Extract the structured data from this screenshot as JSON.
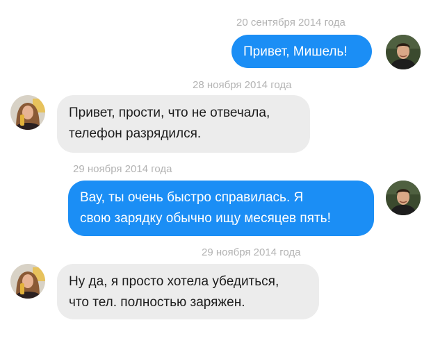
{
  "messages": [
    {
      "timestamp": "20 сентября 2014 года",
      "lines": [
        "Привет, Мишель!"
      ],
      "sender": "him"
    },
    {
      "timestamp": "28 ноября 2014 года",
      "lines": [
        "Привет, прости, что не отвечала,",
        "телефон разрядился."
      ],
      "sender": "her"
    },
    {
      "timestamp": "29 ноября 2014 года",
      "lines": [
        "Вау, ты очень быстро справилась. Я",
        "свою зарядку обычно ищу месяцев пять!"
      ],
      "sender": "him"
    },
    {
      "timestamp": "29 ноября 2014 года",
      "lines": [
        "Ну да, я просто хотела убедиться,",
        "что тел. полностью заряжен."
      ],
      "sender": "her"
    }
  ],
  "colors": {
    "outgoing_bubble": "#1b8ef5",
    "incoming_bubble": "#ececec",
    "timestamp_text": "#b3b3b3"
  },
  "icons": {
    "him_avatar": "man-avatar-icon",
    "her_avatar": "woman-avatar-icon"
  }
}
